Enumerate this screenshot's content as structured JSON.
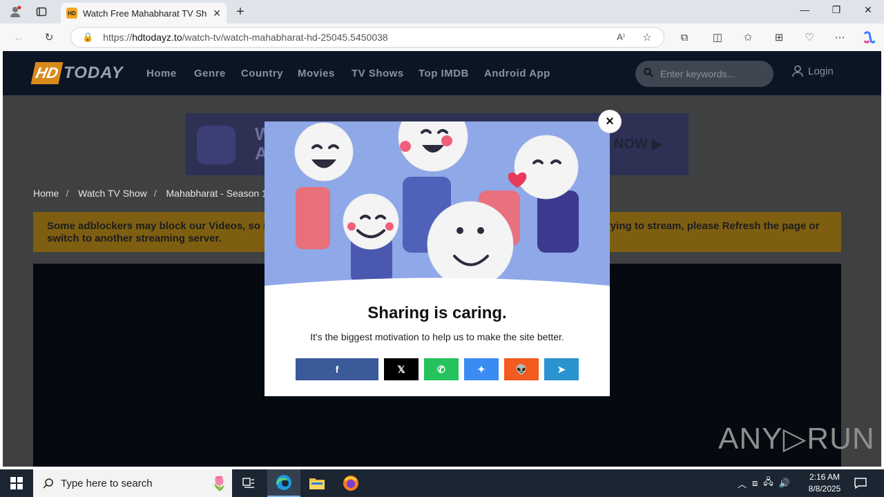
{
  "browser": {
    "tab_title": "Watch Free Mahabharat TV Show",
    "tab_favicon": "HD",
    "url_prefix": "https://",
    "url_domain": "hdtodayz.to",
    "url_path": "/watch-tv/watch-mahabharat-hd-25045.5450038"
  },
  "site": {
    "logo_hd": "HD",
    "logo_today": "TODAY",
    "nav": [
      "Home",
      "Genre",
      "Country",
      "Movies",
      "TV Shows",
      "Top IMDB",
      "Android App"
    ],
    "search_placeholder": "Enter keywords...",
    "login": "Login"
  },
  "banner": {
    "line1": "W",
    "line2": "A",
    "right_text": "H NOW"
  },
  "breadcrumb": [
    "Home",
    "Watch TV Show",
    "Mahabharat - Season 1 -"
  ],
  "notice": {
    "left": "Some adblockers may block our Videos, so i",
    "left2": "switch to another streaming server.",
    "right": "rying to stream, please Refresh the page or"
  },
  "modal": {
    "title": "Sharing is caring.",
    "subtitle": "It's the biggest motivation to help us to make the site better.",
    "close": "×",
    "share_buttons": [
      {
        "name": "facebook",
        "glyph": "f",
        "color": "#3b5a9a"
      },
      {
        "name": "x",
        "glyph": "𝕏",
        "color": "#000000"
      },
      {
        "name": "whatsapp",
        "glyph": "✆",
        "color": "#25c35d"
      },
      {
        "name": "messenger",
        "glyph": "✦",
        "color": "#3b8cf2"
      },
      {
        "name": "reddit",
        "glyph": "👽",
        "color": "#f25a1e"
      },
      {
        "name": "telegram",
        "glyph": "➤",
        "color": "#2b93cf"
      }
    ]
  },
  "watermark": "ANY▷RUN",
  "taskbar": {
    "search_placeholder": "Type here to search",
    "time": "2:16 AM",
    "date": "8/8/2025"
  }
}
